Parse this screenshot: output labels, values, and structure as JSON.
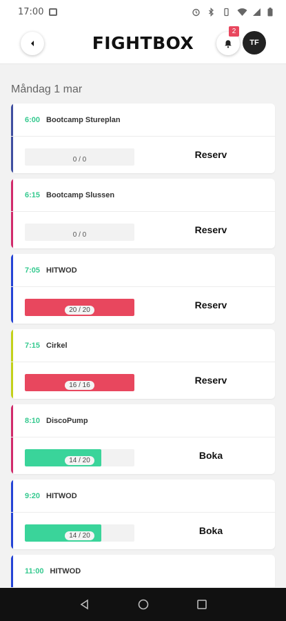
{
  "status_bar": {
    "time": "17:00",
    "icons": [
      "image-icon",
      "alarm-icon",
      "bluetooth-icon",
      "vibrate-icon",
      "wifi-icon",
      "signal-icon",
      "battery-icon"
    ]
  },
  "header": {
    "logo": "FIGHTBOX",
    "notification_count": "2",
    "avatar_initials": "TF"
  },
  "day_heading": "Måndag 1 mar",
  "colors": {
    "time_green": "#35c98f",
    "full_red": "#e8475e",
    "available_green": "#3ad49a"
  },
  "classes": [
    {
      "time": "6:00",
      "name": "Bootcamp Stureplan",
      "count": "0 / 0",
      "fill_fraction": 0,
      "fill_color": "#f2f2f2",
      "action": "Reserv",
      "accent": "#3e4ea0"
    },
    {
      "time": "6:15",
      "name": "Bootcamp Slussen",
      "count": "0 / 0",
      "fill_fraction": 0,
      "fill_color": "#f2f2f2",
      "action": "Reserv",
      "accent": "#d12a6b"
    },
    {
      "time": "7:05",
      "name": "HITWOD",
      "count": "20 / 20",
      "fill_fraction": 1,
      "fill_color": "#e8475e",
      "action": "Reserv",
      "accent": "#2443d6"
    },
    {
      "time": "7:15",
      "name": "Cirkel",
      "count": "16 / 16",
      "fill_fraction": 1,
      "fill_color": "#e8475e",
      "action": "Reserv",
      "accent": "#c3d11a"
    },
    {
      "time": "8:10",
      "name": "DiscoPump",
      "count": "14 / 20",
      "fill_fraction": 0.7,
      "fill_color": "#3ad49a",
      "action": "Boka",
      "accent": "#d12a6b"
    },
    {
      "time": "9:20",
      "name": "HITWOD",
      "count": "14 / 20",
      "fill_fraction": 0.7,
      "fill_color": "#3ad49a",
      "action": "Boka",
      "accent": "#2443d6"
    },
    {
      "time": "11:00",
      "name": "HITWOD",
      "count": "",
      "fill_fraction": 0,
      "fill_color": "#f2f2f2",
      "action": "",
      "accent": "#2443d6"
    }
  ],
  "nav": [
    "back-nav",
    "home-nav",
    "recents-nav"
  ]
}
